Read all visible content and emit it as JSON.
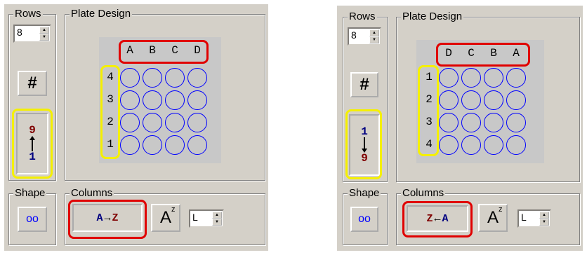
{
  "left": {
    "rows": {
      "title": "Rows",
      "value": "8",
      "hash_label": "#",
      "order_top": "9",
      "order_bottom": "1"
    },
    "plate": {
      "title": "Plate Design",
      "col_labels": [
        "A",
        "B",
        "C",
        "D"
      ],
      "row_labels": [
        "4",
        "3",
        "2",
        "1"
      ]
    },
    "shape": {
      "title": "Shape",
      "glyph": "oo"
    },
    "columns": {
      "title": "Columns",
      "from": "A",
      "arrow": "→",
      "to": "Z",
      "az_main": "A",
      "az_sup": "z",
      "value": "L"
    }
  },
  "right": {
    "rows": {
      "title": "Rows",
      "value": "8",
      "hash_label": "#",
      "order_top": "1",
      "order_bottom": "9"
    },
    "plate": {
      "title": "Plate Design",
      "col_labels": [
        "D",
        "C",
        "B",
        "A"
      ],
      "row_labels": [
        "1",
        "2",
        "3",
        "4"
      ]
    },
    "shape": {
      "title": "Shape",
      "glyph": "oo"
    },
    "columns": {
      "title": "Columns",
      "from": "Z",
      "arrow": "←",
      "to": "A",
      "az_main": "A",
      "az_sup": "z",
      "value": "L"
    }
  },
  "colors": {
    "panel": "#d4d0c8",
    "highlight_red": "#e00000",
    "highlight_yellow": "#f5f000",
    "well": "#0000ff",
    "order_high": "#800000",
    "order_low": "#000080"
  }
}
